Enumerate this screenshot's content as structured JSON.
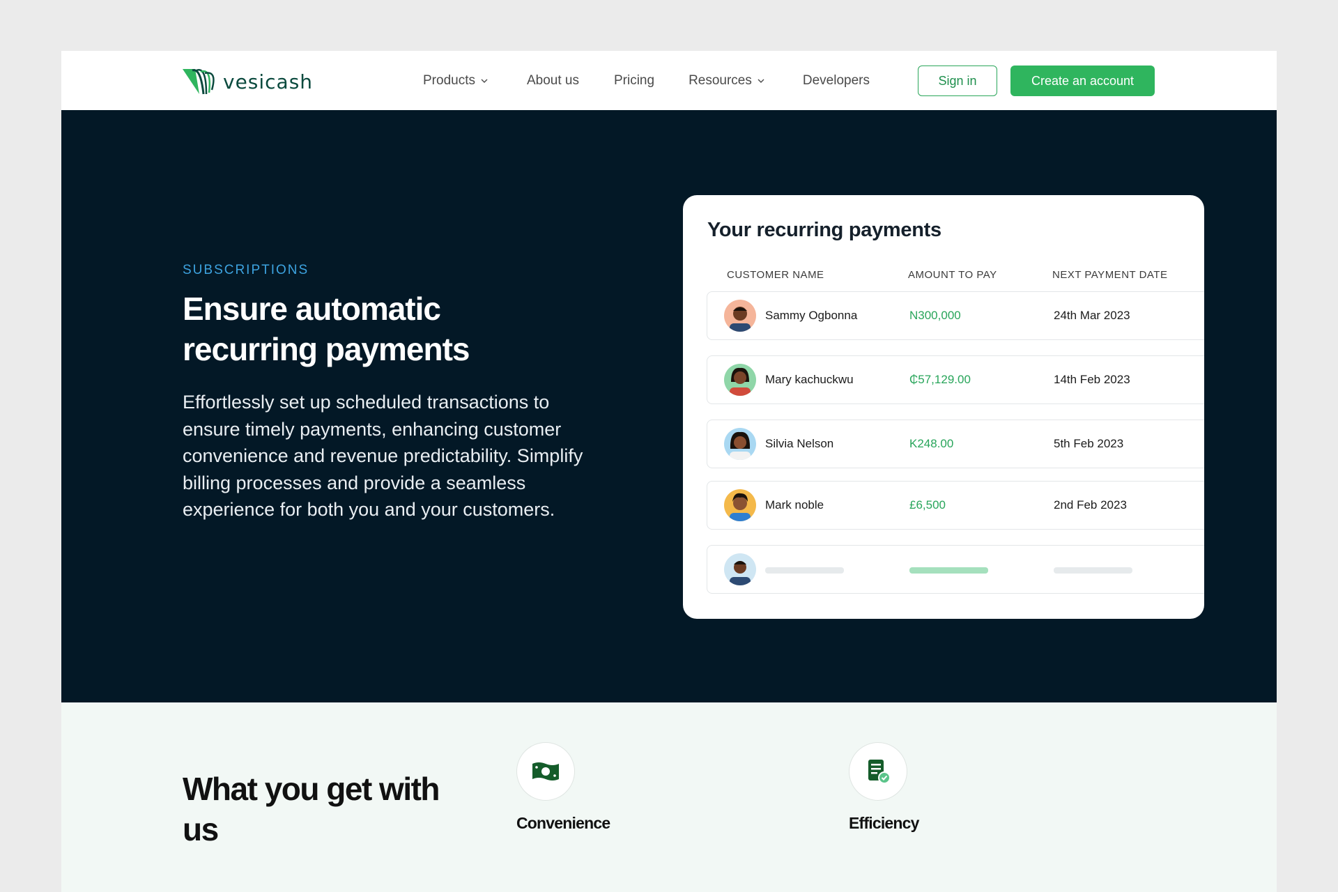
{
  "nav": {
    "brand": "vesicash",
    "links": [
      "Products",
      "About us",
      "Pricing",
      "Resources",
      "Developers"
    ],
    "signin": "Sign in",
    "create": "Create an account"
  },
  "hero": {
    "eyebrow": "SUBSCRIPTIONS",
    "title": "Ensure automatic recurring payments",
    "description": "Effortlessly set up scheduled transactions to ensure timely payments, enhancing customer convenience and revenue predictability. Simplify billing processes and provide a seamless experience for both you and your customers."
  },
  "card": {
    "title": "Your recurring payments",
    "columns": [
      "CUSTOMER NAME",
      "AMOUNT TO PAY",
      "NEXT PAYMENT DATE"
    ],
    "rows": [
      {
        "name": "Sammy Ogbonna",
        "amount": "N300,000",
        "date": "24th Mar 2023"
      },
      {
        "name": "Mary kachuckwu",
        "amount": "₵57,129.00",
        "date": "14th Feb 2023"
      },
      {
        "name": "Silvia Nelson",
        "amount": "K248.00",
        "date": "5th Feb 2023"
      },
      {
        "name": "Mark noble",
        "amount": "£6,500",
        "date": "2nd Feb 2023"
      }
    ]
  },
  "features": {
    "title": "What you get with us",
    "items": [
      {
        "label": "Convenience",
        "icon": "cash-icon"
      },
      {
        "label": "Efficiency",
        "icon": "document-check-icon"
      }
    ]
  },
  "colors": {
    "accent": "#2fb55e",
    "hero_bg": "#031826",
    "eyebrow": "#3da3e0",
    "amount": "#28a55a",
    "features_bg": "#f2f8f5"
  }
}
